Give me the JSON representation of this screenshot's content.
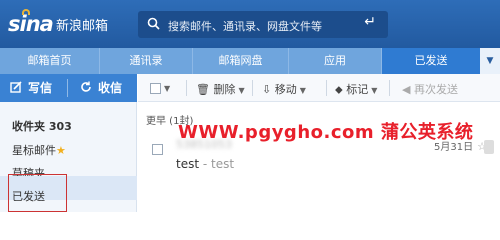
{
  "header": {
    "logo": "sina",
    "brand": "新浪邮箱",
    "search_placeholder": "搜索邮件、通讯录、网盘文件等",
    "enter_icon": "enter-icon"
  },
  "nav": {
    "tabs": [
      "邮箱首页",
      "通讯录",
      "邮箱网盘",
      "应用",
      "已发送"
    ],
    "active": "已发送"
  },
  "sidebar": {
    "write_label": "写信",
    "receive_label": "收信",
    "folders": {
      "inbox": "收件夹 303",
      "starred": "星标邮件",
      "drafts": "草稿夹",
      "sent": "已发送"
    }
  },
  "toolbar": {
    "delete": "删除",
    "move": "移动",
    "mark": "标记",
    "forward": "再次发送"
  },
  "mail_list": {
    "group": "更早 (1封)",
    "items": [
      {
        "sender": "53851053",
        "subject": "test",
        "preview": "- test",
        "date": "5月31日"
      }
    ]
  },
  "watermark": "WWW.pgygho.com 蒲公英系统"
}
